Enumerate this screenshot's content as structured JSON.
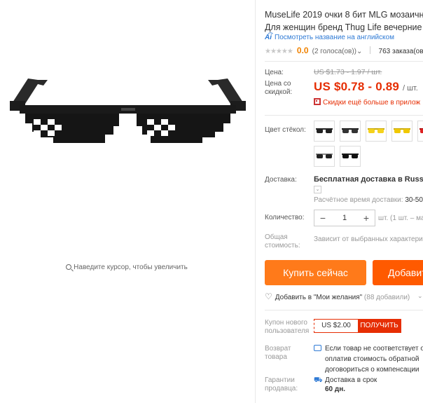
{
  "product": {
    "title_line1": "MuseLife 2019 очки 8 бит MLG мозаичн",
    "title_line2": "Для женщин бренд Thug Life вечерние",
    "translate_link": "Посмотреть название на английском",
    "translate_icon": "ai-translate-icon"
  },
  "rating": {
    "stars": "★★★★★",
    "score": "0.0",
    "votes": "(2 голоса(ов))",
    "votes_caret": "⌄",
    "orders": "763 заказа(ов"
  },
  "price": {
    "label_price": "Цена:",
    "old_price": "US $1.73 - 1.97 / шт.",
    "label_discount_line1": "Цена со",
    "label_discount_line2": "скидкой:",
    "current_price": "US $0.78 - 0.89",
    "unit": "/ шт.",
    "discount_note": "Скидки ещё больше в прилож"
  },
  "color": {
    "label": "Цвет стёкол:",
    "swatches": [
      "black-lens",
      "black-lens-2",
      "yellow-lens",
      "yellow-lens-2",
      "red-lens",
      "dark-lens",
      "dark-lens-2"
    ]
  },
  "shipping": {
    "label": "Доставка:",
    "value": "Бесплатная доставка в Russian",
    "dropdown_icon": "⌄",
    "time_label": "Расчётное время доставки:",
    "time_value": "30-50"
  },
  "quantity": {
    "label": "Количество:",
    "minus": "−",
    "value": "1",
    "plus": "+",
    "note": "шт. (1 шт. – ма"
  },
  "total": {
    "label_line1": "Общая",
    "label_line2": "стоимость:",
    "note": "Зависит от выбранных характери"
  },
  "actions": {
    "buy_now": "Купить сейчас",
    "add_to_cart": "Добавит"
  },
  "wishlist": {
    "heart": "♡",
    "text": "Добавить в \"Мои желания\"",
    "count": "(88 добавили)",
    "caret": "⌄"
  },
  "coupon": {
    "label_line1": "Купон нового",
    "label_line2": "пользователя",
    "amount": "US $2.00",
    "get": "ПОЛУЧИТЬ"
  },
  "returns": {
    "label_line1": "Возврат",
    "label_line2": "товара",
    "line1": "Если товар не соответствует о",
    "line2": "оплатив стоимость обратной",
    "line3": "договориться о компенсации"
  },
  "guarantee": {
    "label_line1": "Гарантии",
    "label_line2": "продавца:",
    "truck_icon": "⛟",
    "line1": "Доставка в срок",
    "line2": "60 дн."
  },
  "gallery": {
    "zoom_hint": "Наведите курсор, чтобы увеличить"
  },
  "colors": {
    "accent_orange": "#ff7a1a",
    "cart_orange": "#ff5a00",
    "price_red": "#e62e04",
    "link_blue": "#2e7ad5"
  }
}
